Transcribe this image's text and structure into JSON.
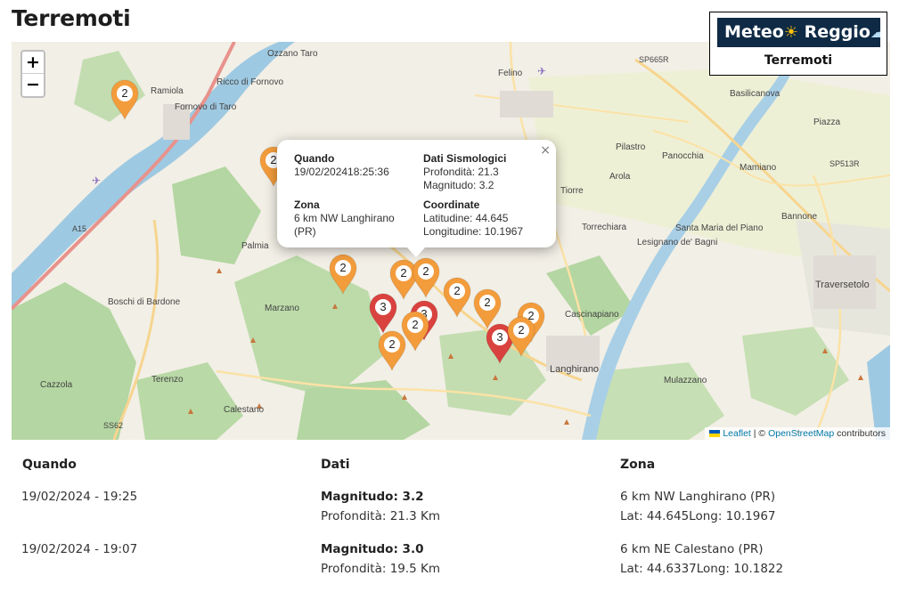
{
  "page": {
    "title": "Terremoti"
  },
  "logo": {
    "brand_part1": "Meteo",
    "brand_part2": "Reggio",
    "subtitle": "Terremoti"
  },
  "map": {
    "zoom_in": "+",
    "zoom_out": "−",
    "place_labels": [
      "Ozzano Taro",
      "Ramiola",
      "Ricco di Fornovo",
      "Fornovo di Taro",
      "Felino",
      "SP665R",
      "Basilicanova",
      "Piazza",
      "Pilastro",
      "Panocchia",
      "Mamiano",
      "SP513R",
      "Arola",
      "Tiorre",
      "Torrechiara",
      "Bannone",
      "Santa Maria del Piano",
      "Lesignano de' Bagni",
      "Traversetolo",
      "Palmia",
      "Boschi di Bardone",
      "Marzano",
      "Cascinapiano",
      "Langhirano",
      "Cazzola",
      "Terenzo",
      "Mulazzano",
      "Calestano",
      "SS62",
      "A15"
    ],
    "clusters": [
      {
        "count": "2",
        "color": "orange"
      },
      {
        "count": "2",
        "color": "orange"
      },
      {
        "count": "2",
        "color": "orange"
      },
      {
        "count": "2",
        "color": "orange"
      },
      {
        "count": "2",
        "color": "orange"
      },
      {
        "count": "2",
        "color": "orange"
      },
      {
        "count": "2",
        "color": "orange"
      },
      {
        "count": "3",
        "color": "red"
      },
      {
        "count": "3",
        "color": "red"
      },
      {
        "count": "2",
        "color": "orange"
      },
      {
        "count": "2",
        "color": "orange"
      },
      {
        "count": "2",
        "color": "orange"
      },
      {
        "count": "3",
        "color": "red"
      },
      {
        "count": "2",
        "color": "orange"
      }
    ],
    "popup": {
      "when_label": "Quando",
      "when_value": "19/02/202418:25:36",
      "zone_label": "Zona",
      "zone_value_line1": "6 km NW Langhirano",
      "zone_value_line2": "(PR)",
      "seismo_label": "Dati Sismologici",
      "depth_line": "Profondità: 21.3",
      "magnitude_line": "Magnitudo: 3.2",
      "coords_label": "Coordinate",
      "lat_line": "Latitudine: 44.645",
      "lon_line": "Longitudine: 10.1967",
      "close_symbol": "×"
    },
    "attribution": {
      "leaflet": "Leaflet",
      "separator": " | © ",
      "osm": "OpenStreetMap",
      "suffix": " contributors"
    }
  },
  "table": {
    "headers": {
      "when": "Quando",
      "data": "Dati",
      "zone": "Zona"
    },
    "rows": [
      {
        "when": "19/02/2024 - 19:25",
        "magnitude": "Magnitudo: 3.2",
        "depth": "Profondità: 21.3 Km",
        "zone": "6 km NW Langhirano (PR)",
        "coords": "Lat: 44.645Long: 10.1967"
      },
      {
        "when": "19/02/2024 - 19:07",
        "magnitude": "Magnitudo: 3.0",
        "depth": "Profondità: 19.5 Km",
        "zone": "6 km NE Calestano (PR)",
        "coords": "Lat: 44.6337Long: 10.1822"
      }
    ]
  },
  "colors": {
    "orange_marker": "#f39c3c",
    "red_marker": "#d9423e",
    "river": "#9ec9e2",
    "forest": "#b4d6a2",
    "motorway": "#e8928c"
  }
}
